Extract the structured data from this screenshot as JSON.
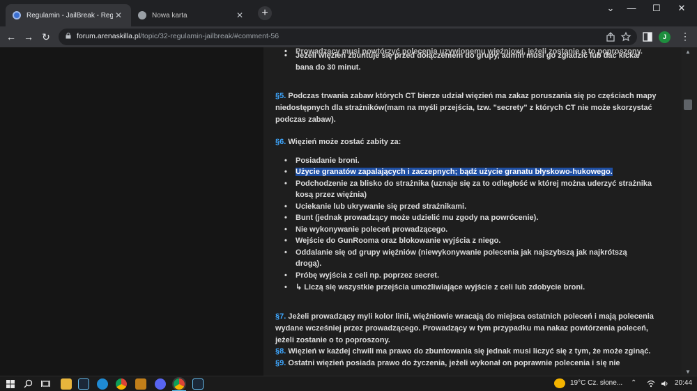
{
  "tabs": [
    {
      "title": "Regulamin - JailBreak - Regulam",
      "close": "✕"
    },
    {
      "title": "Nowa karta",
      "close": "✕"
    }
  ],
  "new_tab": "+",
  "window_controls": {
    "dropdown": "⌄",
    "minimize": "—",
    "maximize": "☐",
    "close": "✕"
  },
  "nav": {
    "back": "←",
    "forward": "→",
    "reload": "↻"
  },
  "address": {
    "host": "forum.arenaskilla.pl",
    "path": "/topic/32-regulamin-jailbreak/#comment-56"
  },
  "profile_initial": "J",
  "post": {
    "top_cut_line": "Prowadzący musi powtórzyć polecenia uzywionemu więźniowi, jeżeli zostanie o to poproszony.",
    "top_bullet_1": "Jeżeli więzień zbuntuje się przed dołączeniem do grupy, admin musi go zgładzić lub dać kicka/",
    "top_bullet_1b": "bana do 30 minut.",
    "s5_num": "§5.",
    "s5_lines": [
      " Podczas trwania zabaw których CT bierze udział więzień ma zakaz poruszania się po częściach mapy",
      "niedostępnych dla strażników(mam na myśli przejścia, tzw. \"secrety\" z których CT nie może skorzystać",
      "podczas zabaw)."
    ],
    "s6_num": "§6.",
    "s6_text": " Więzień może zostać zabity za:",
    "s6_items": [
      "Posiadanie broni.",
      "Użycie granatów zapalających i zaczepnych; bądź użycie granatu błyskowo-hukowego.",
      "Podchodzenie za blisko do strażnika (uznaje się za to odległość w której można uderzyć strażnika",
      "kosą przez więźnia)",
      "Uciekanie lub ukrywanie się przed strażnikami.",
      "Bunt (jednak prowadzący może udzielić mu zgody na powrócenie).",
      "Nie wykonywanie poleceń prowadzącego.",
      "Wejście do GunRooma oraz blokowanie wyjścia z niego.",
      "Oddalanie się od grupy więźniów (niewykonywanie polecenia jak najszybszą jak najkrótszą",
      "drogą).",
      "Próbę wyjścia z celi np. poprzez secret.",
      "↳ Liczą się wszystkie przejścia umożliwiające wyjście z celi lub zdobycie broni."
    ],
    "s7_num": "§7.",
    "s7_lines": [
      " Jeżeli prowadzący myli kolor linii, więźniowie wracają do miejsca ostatnich poleceń i mają polecenia",
      "wydane wcześniej przez prowadzącego. Prowadzący w tym przypadku ma nakaz powtórzenia poleceń,",
      "jeżeli zostanie o to poproszony."
    ],
    "s8_num": "§8.",
    "s8_text": " Więzień w każdej chwili ma prawo do zbuntowania się jednak musi liczyć się z tym, że może zginąć.",
    "s9_num": "§9.",
    "s9_text": " Ostatni więzień posiada prawo do życzenia, jeżeli wykonał on poprawnie polecenia i się nie"
  },
  "taskbar": {
    "weather": "19°C  Cz. słone...",
    "tray_chevron": "⌃",
    "time": "20:44"
  },
  "colors": {
    "link": "#3ea7ff",
    "highlight": "#1f4fa3"
  }
}
